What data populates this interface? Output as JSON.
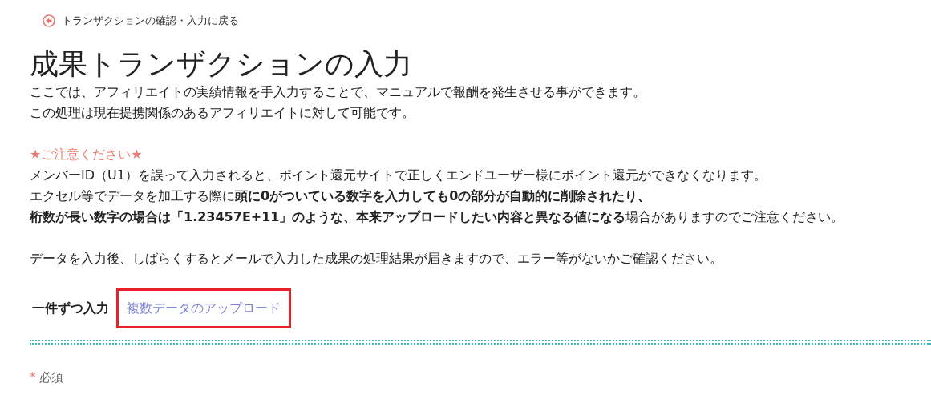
{
  "back_link": {
    "label": "トランザクションの確認・入力に戻る"
  },
  "title": "成果トランザクションの入力",
  "intro": [
    "ここでは、アフィリエイトの実績情報を手入力することで、マニュアルで報酬を発生させる事ができます。",
    "この処理は現在提携関係のあるアフィリエイトに対して可能です。"
  ],
  "notice": {
    "heading": "★ご注意ください★",
    "lines": [
      "メンバーID（U1）を誤って入力されると、ポイント還元サイトで正しくエンドユーザー様にポイント還元ができなくなります。",
      "エクセル等でデータを加工する際に**頭に0がついている数字を入力しても0の部分が自動的に削除されたり、**",
      "**桁数が長い数字の場合は「1.23457E+11」のような、本来アップロードしたい内容と異なる値になる**場合がありますのでご注意ください。"
    ]
  },
  "after_note": "データを入力後、しばらくするとメールで入力した成果の処理結果が届きますので、エラー等がないかご確認ください。",
  "tabs": [
    {
      "label": "一件ずつ入力",
      "selected": true,
      "highlighted": false
    },
    {
      "label": "複数データのアップロード",
      "selected": false,
      "highlighted": true
    }
  ],
  "required_note": {
    "mark": "*",
    "label": "必須"
  }
}
